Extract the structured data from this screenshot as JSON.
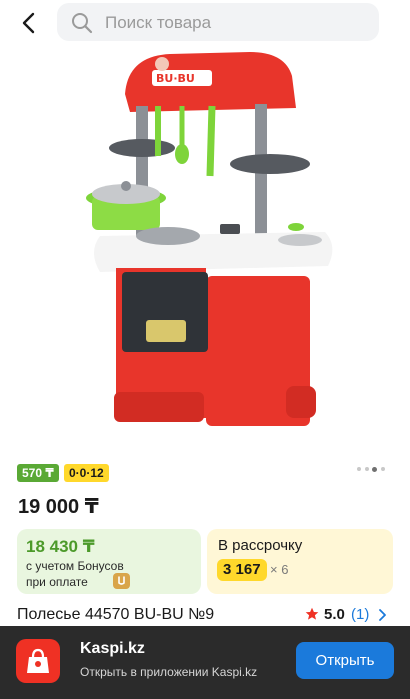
{
  "header": {
    "search_placeholder": "Поиск товара",
    "back_icon": "chevron-left-icon",
    "search_icon": "search-icon"
  },
  "product": {
    "image_alt_icon": "toy-kitchen-image",
    "gallery": {
      "count": 4,
      "active_index": 2
    },
    "badges": {
      "bonus": "570 ₸",
      "installment": "0·0·12"
    },
    "price": "19 000 ₸",
    "bonus_card": {
      "price": "18 430 ₸",
      "line1": "с учетом Бонусов",
      "line2": "при оплате"
    },
    "installment_card": {
      "title": "В рассрочку",
      "amount": "3 167",
      "multiplier": "× 6"
    },
    "title": "Полесье 44570 BU-BU №9",
    "rating": {
      "value": "5.0",
      "count": "(1)"
    }
  },
  "app_banner": {
    "name": "Kaspi.kz",
    "subtitle": "Открыть в приложении Kaspi.kz",
    "open_label": "Открыть"
  },
  "colors": {
    "brand_red": "#ef3124",
    "bonus_green": "#5aa935",
    "installment_yellow": "#ffd82b",
    "link_blue": "#1b7adb"
  }
}
